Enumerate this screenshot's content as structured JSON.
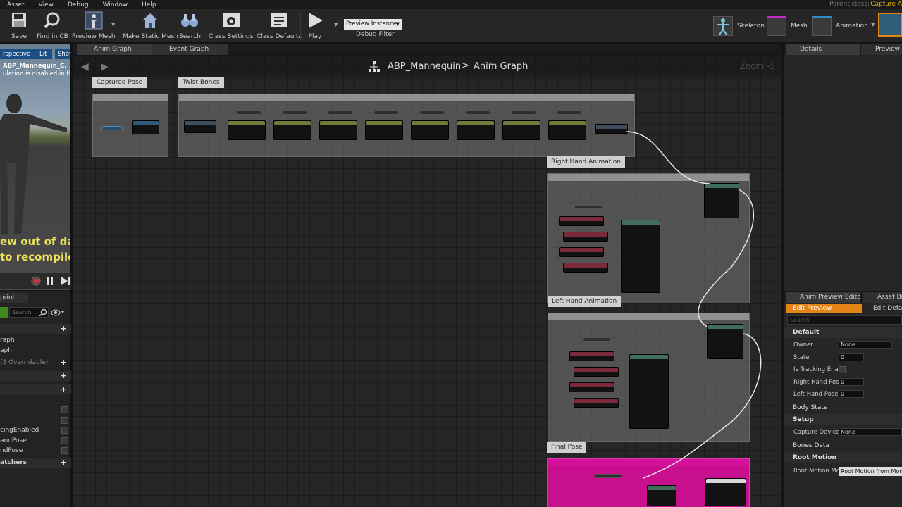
{
  "menu": {
    "items": [
      "Asset",
      "View",
      "Debug",
      "Window",
      "Help"
    ],
    "parent_class_label": "Parent class:",
    "parent_class_value": "Capture A"
  },
  "toolbar": {
    "save": "Save",
    "find_in_cb": "Find in CB",
    "preview_mesh": "Preview Mesh",
    "make_static_mesh": "Make Static Mesh",
    "search": "Search",
    "class_settings": "Class Settings",
    "class_defaults": "Class Defaults",
    "play": "Play",
    "preview_instance": "Preview Instance",
    "debug_filter": "Debug Filter",
    "skeleton": "Skeleton",
    "mesh": "Mesh",
    "animation": "Animation"
  },
  "viewport": {
    "perspective": "rspective",
    "lit": "Lit",
    "show": "Show",
    "info_line1": "ABP_Mannequin_C.",
    "info_line2": "ulation is disabled in this",
    "warning_line1": "ew out of date",
    "warning_line2": "to recompile"
  },
  "my_blueprint": {
    "tab": "print",
    "search_placeholder": "Search",
    "rows": [
      {
        "label": "raph",
        "kind": "item"
      },
      {
        "label": "aph",
        "kind": "item"
      },
      {
        "label": "(3 Overridable)",
        "kind": "muted"
      },
      {
        "label": "cingEnabled",
        "kind": "var"
      },
      {
        "label": "andPose",
        "kind": "var"
      },
      {
        "label": "ndPose",
        "kind": "var"
      },
      {
        "label": "atchers",
        "kind": "head"
      }
    ]
  },
  "graph": {
    "tabs": [
      "Anim Graph",
      "Event Graph"
    ],
    "crumb_root": "ABP_Mannequin",
    "crumb_sep": ">",
    "crumb_leaf": "Anim Graph",
    "zoom": "Zoom -5",
    "comments": {
      "captured_pose": "Captured Pose",
      "twist_bones": "Twist Bones",
      "right_hand": "Right Hand Animation",
      "left_hand": "Left Hand Animation",
      "final_pose": "Final Pose"
    }
  },
  "details": {
    "tab1": "Details",
    "tab2": "Preview Sc"
  },
  "anim_preview": {
    "tab1": "Anim Preview Editor",
    "tab2": "Asset Bro",
    "edit_preview": "Edit Preview",
    "edit_defaults": "Edit Defau",
    "search_placeholder": "Search",
    "cat_default": "Default",
    "owner_label": "Owner",
    "owner_value": "None",
    "state_label": "State",
    "state_value": "0",
    "tracking_label": "Is Tracking Enab",
    "rhp_label": "Right Hand Pose",
    "rhp_value": "0",
    "lhp_label": "Left Hand Pose",
    "lhp_value": "0",
    "cat_body_state": "Body State",
    "cat_setup": "Setup",
    "capture_device_label": "Capture Device",
    "capture_device_value": "None",
    "cat_bones_data": "Bones Data",
    "cat_root_motion": "Root Motion",
    "root_motion_label": "Root Motion Moc",
    "root_motion_value": "Root Motion from Mont"
  },
  "colors": {
    "accent_orange": "#e48417",
    "final_pose_magenta": "#d4119b",
    "parent_class": "#e8b400",
    "warning_yellow": "#ece15a"
  }
}
